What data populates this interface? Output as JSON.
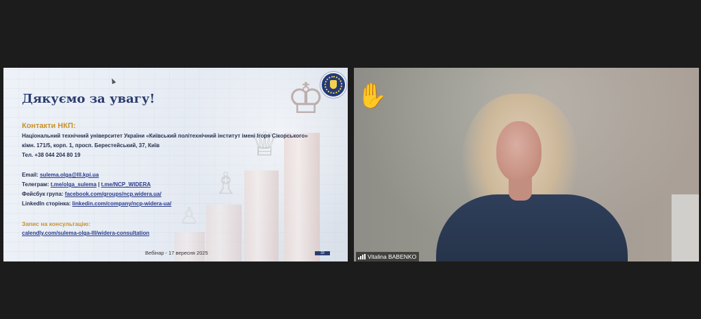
{
  "slide": {
    "title": "Дякуємо за увагу!",
    "contacts_heading": "Контакти НКП:",
    "org_line": "Національний технічний університет України «Київський політехнічний інститут імені Ігоря Сікорського»",
    "address_line": "кімн. 171/5, корп. 1, просп. Берестейський, 37, Київ",
    "phone_line": "Тел. +38 044 204 80 19",
    "email_label": "Email: ",
    "email_value": "sulema.olga@lll.kpi.ua",
    "telegram_label": "Телеграм: ",
    "telegram_link1": "t.me/olga_sulema",
    "telegram_sep": " | ",
    "telegram_link2": "t.me/NCP_WIDERA",
    "facebook_label": "Фейсбук група: ",
    "facebook_link": "facebook.com/groups/ncp.widera.ua/",
    "linkedin_label": "LinkedIn сторінка: ",
    "linkedin_link": "linkedin.com/company/ncp-widera-ua/",
    "consult_heading": "Запис на консультацію:",
    "consult_link": "calendly.com/sulema-olga-lll/widera-consultation",
    "footer": "Вебінар - 17 вересня 2025",
    "page_number": "33",
    "logo_icon": "university-seal-icon"
  },
  "video": {
    "participant_name": "Vitalina BABENKO",
    "reaction_icon": "raised-hand-icon",
    "signal_icon": "signal-strength-icon"
  }
}
